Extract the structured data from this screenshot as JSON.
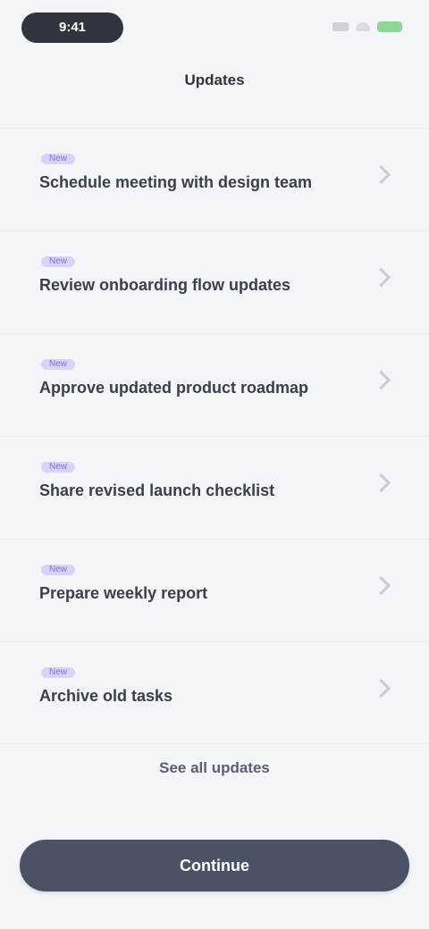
{
  "status": {
    "time": "9:41"
  },
  "header": {
    "title": "Updates"
  },
  "items": [
    {
      "tag": "New",
      "title": "Schedule meeting with design team"
    },
    {
      "tag": "New",
      "title": "Review onboarding flow updates"
    },
    {
      "tag": "New",
      "title": "Approve updated product roadmap"
    },
    {
      "tag": "New",
      "title": "Share revised launch checklist"
    },
    {
      "tag": "New",
      "title": "Prepare weekly report"
    },
    {
      "tag": "New",
      "title": "Archive old tasks"
    }
  ],
  "footer": {
    "link_label": "See all updates",
    "button_label": "Continue"
  },
  "colors": {
    "accent": "#7d6fe0",
    "button": "#4a5366",
    "battery": "#8ed59a"
  }
}
